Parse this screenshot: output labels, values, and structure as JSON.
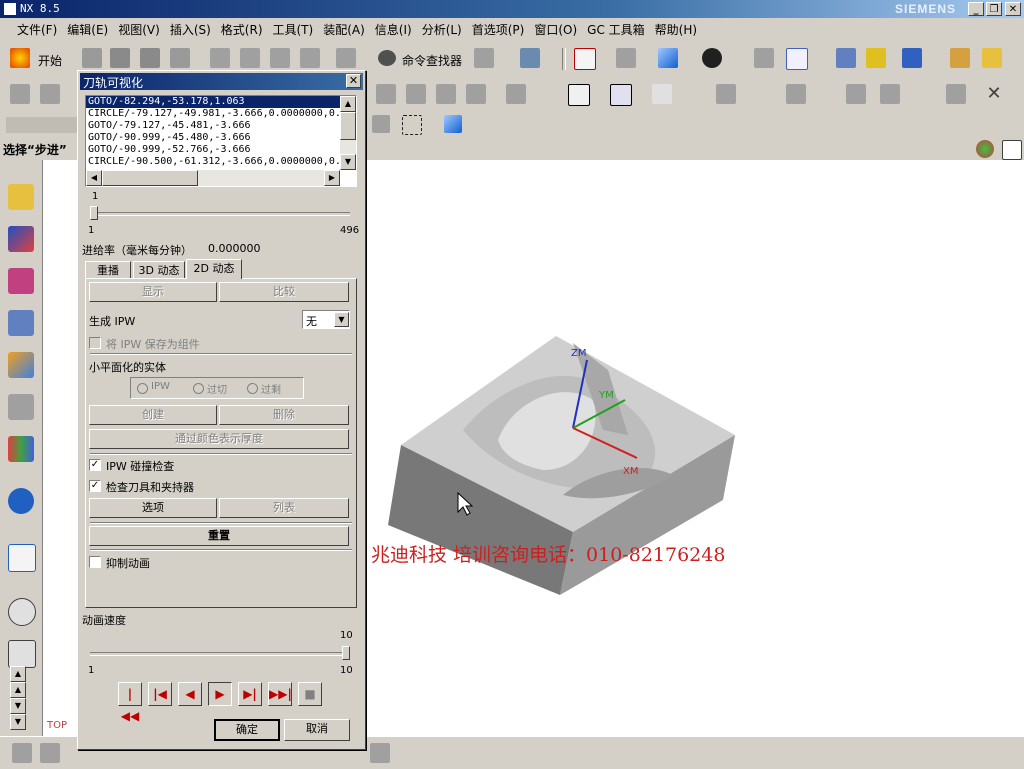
{
  "window": {
    "title": "NX 8.5",
    "brand": "SIEMENS",
    "min": "_",
    "restore": "❐",
    "close": "✕"
  },
  "menu": [
    "文件(F)",
    "编辑(E)",
    "视图(V)",
    "插入(S)",
    "格式(R)",
    "工具(T)",
    "装配(A)",
    "信息(I)",
    "分析(L)",
    "首选项(P)",
    "窗口(O)",
    "GC 工具箱",
    "帮助(H)"
  ],
  "toolbar": {
    "start_label": "开始",
    "command_finder_label": "命令查找器"
  },
  "selection_label": "选择“步进”",
  "viewport": {
    "watermark": "兆迪科技    培训咨询电话：010-82176248",
    "view_label": "TOP",
    "axes": {
      "z": "ZM",
      "y": "YM",
      "x": "XM"
    }
  },
  "dialog": {
    "title": "刀轨可视化",
    "close": "✕",
    "list": [
      "GOTO/-82.294,-53.178,1.063",
      "CIRCLE/-79.127,-49.981,-3.666,0.0000000,0.",
      "GOTO/-79.127,-45.481,-3.666",
      "GOTO/-90.999,-45.480,-3.666",
      "GOTO/-90.999,-52.766,-3.666",
      "CIRCLE/-90.500,-61.312,-3.666,0.0000000,0."
    ],
    "slider": {
      "current": "1",
      "min": "1",
      "max": "496",
      "value": 0
    },
    "feed_label": "进给率（毫米每分钟）",
    "feed_value": "0.000000",
    "tabs": [
      "重播",
      "3D 动态",
      "2D 动态"
    ],
    "display_btn": "显示",
    "compare_btn": "比较",
    "ipw_label": "生成 IPW",
    "ipw_value": "无",
    "save_ipw_label": "将 IPW 保存为组件",
    "faceted_label": "小平面化的实体",
    "radio_options": [
      "IPW",
      "过切",
      "过剩"
    ],
    "create_btn": "创建",
    "delete_btn": "删除",
    "thickness_btn": "通过颜色表示厚度",
    "collision_label": "IPW 碰撞检查",
    "check_tool_label": "检查刀具和夹持器",
    "options_btn": "选项",
    "list_btn": "列表",
    "reset_btn": "重置",
    "suppress_label": "抑制动画",
    "speed_label": "动画速度",
    "speed": {
      "current": "10",
      "min": "1",
      "max": "10",
      "value": 10
    },
    "ok_btn": "确定",
    "cancel_btn": "取消"
  },
  "colors": {
    "title_blue": "#0a246a",
    "watermark_red": "#cc2020",
    "part_gray": "#b4b4b4"
  }
}
